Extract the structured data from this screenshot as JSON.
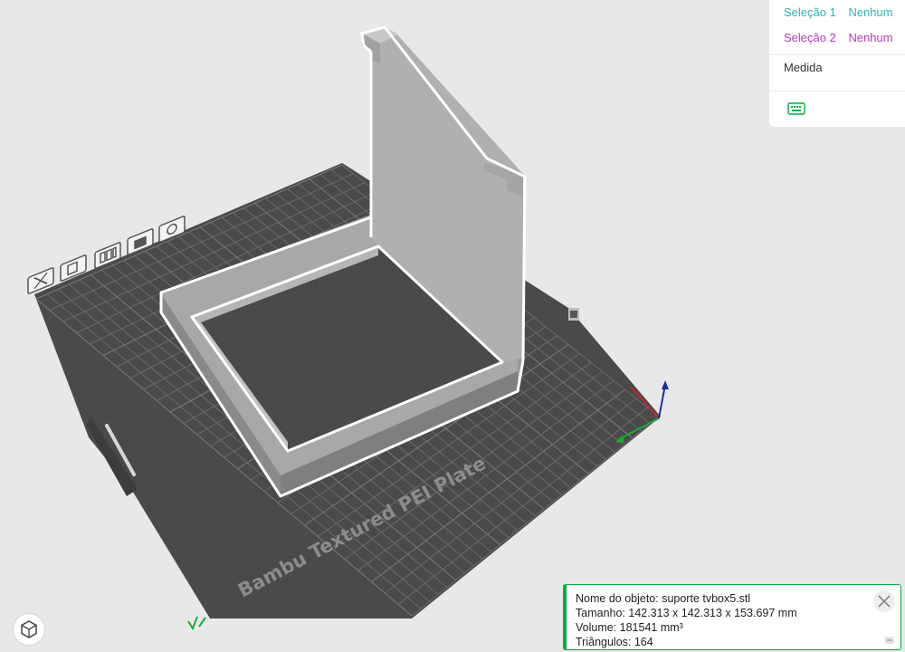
{
  "measure_panel": {
    "selection1_label": "Seleção 1",
    "selection1_value": "Nenhum",
    "selection2_label": "Seleção 2",
    "selection2_value": "Nenhum",
    "measure_label": "Medida",
    "keyboard_icon": "keyboard-icon",
    "colors": {
      "selection1": "#34b3b3",
      "selection2": "#b63ab6"
    }
  },
  "plate": {
    "label": "Bambu Textured PEI Plate",
    "toolbar_icons": [
      "close-icon",
      "auto-orient-icon",
      "arrange-icon",
      "lock-icon",
      "settings-icon"
    ]
  },
  "object_info": {
    "name_line": "Nome do objeto: suporte tvbox5.stl",
    "size_line": "Tamanho: 142.313 x 142.313 x 153.697 mm",
    "volume_line": "Volume: 181541 mm³",
    "triangles_line": "Triângulos: 164",
    "accent": "#00ae42"
  },
  "axes": {
    "x_color": "#c0262d",
    "y_color": "#1fa83a",
    "z_color": "#1a2e9c"
  }
}
